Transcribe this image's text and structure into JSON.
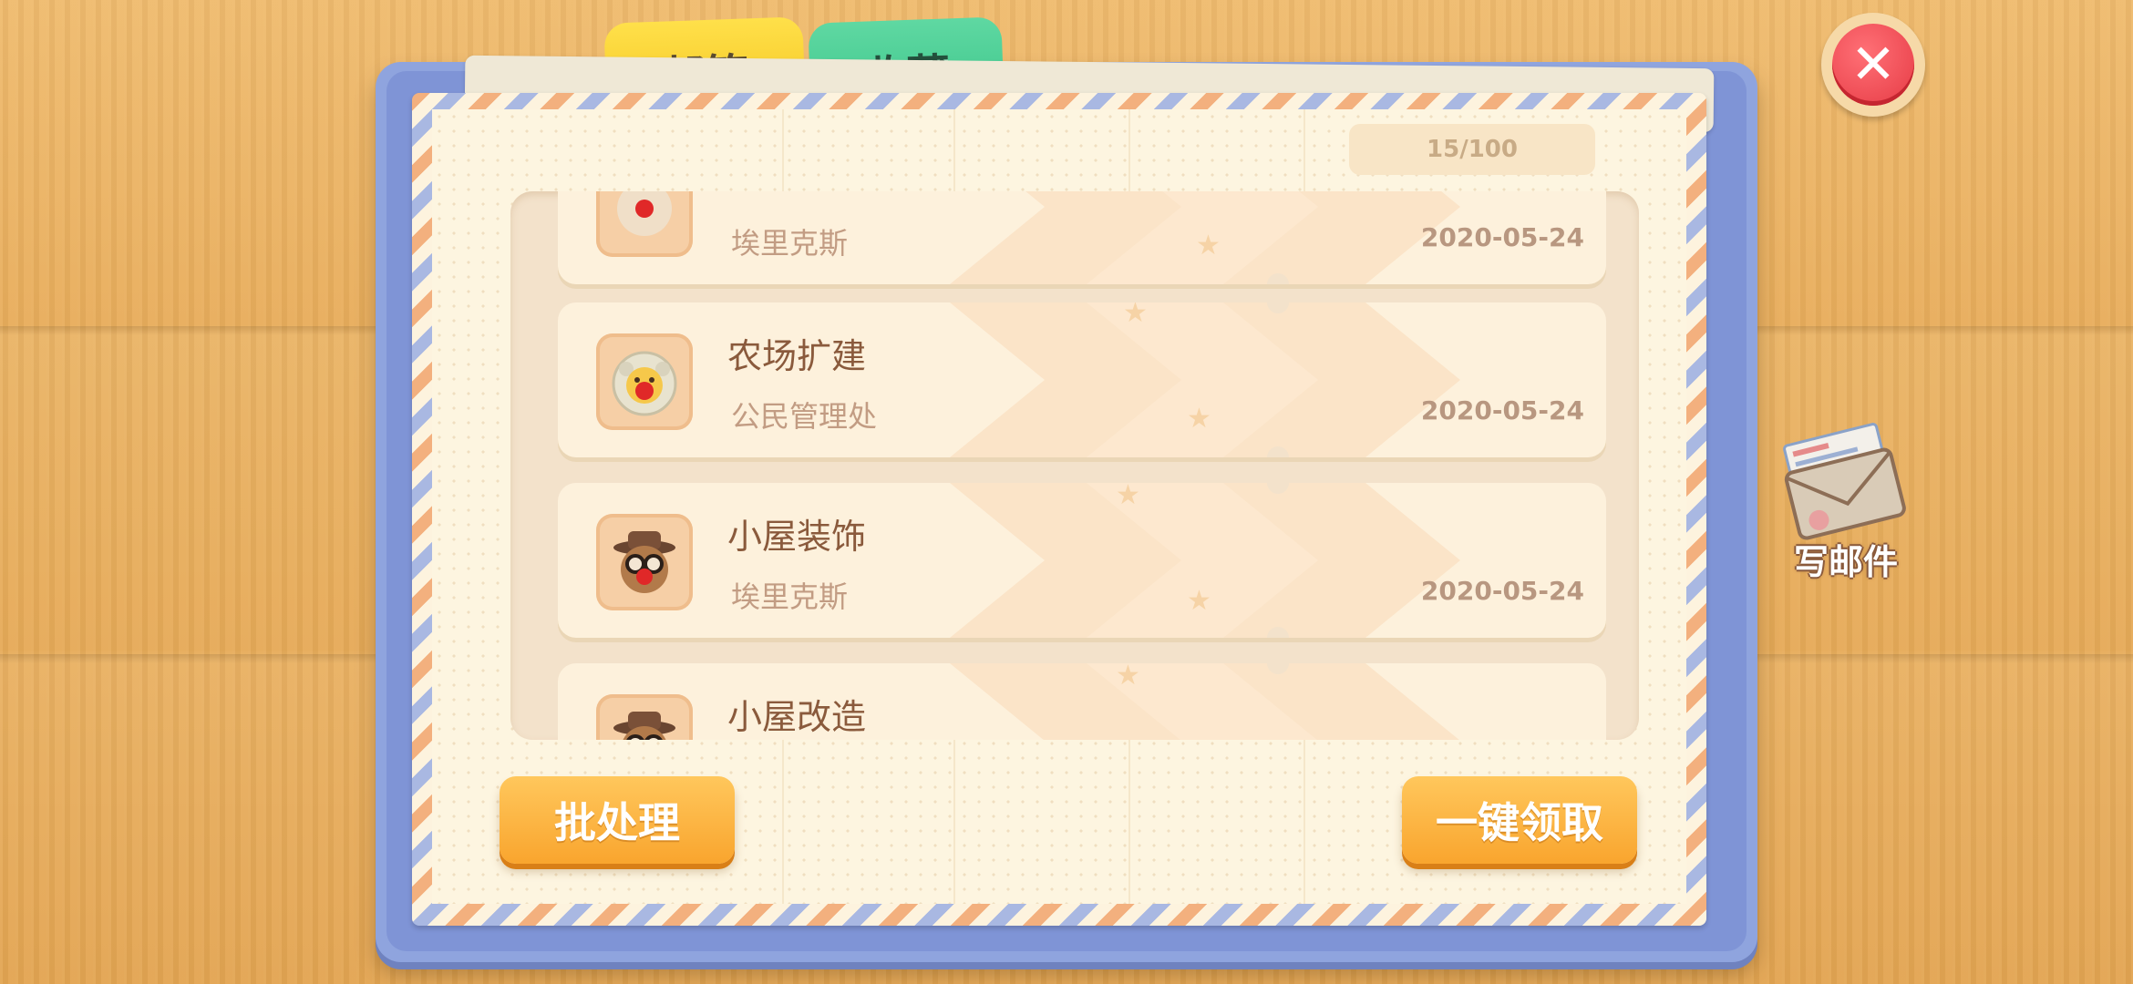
{
  "tabs": [
    {
      "label": "邮箱",
      "active": true
    },
    {
      "label": "收藏",
      "active": false
    }
  ],
  "counter": "15/100",
  "mails": [
    {
      "title": "",
      "sender": "埃里克斯",
      "date": "2020-05-24",
      "icon": "clown-avatar"
    },
    {
      "title": "农场扩建",
      "sender": "公民管理处",
      "date": "2020-05-24",
      "icon": "sheep-clown-avatar"
    },
    {
      "title": "小屋装饰",
      "sender": "埃里克斯",
      "date": "2020-05-24",
      "icon": "hat-glasses-clown-avatar"
    },
    {
      "title": "小屋改造",
      "sender": "",
      "date": "",
      "icon": "hat-glasses-clown-avatar"
    }
  ],
  "buttons": {
    "batch": "批处理",
    "claim_all": "一键领取"
  },
  "write_mail": "写邮件",
  "colors": {
    "accent_orange": "#f9a52e",
    "close_red": "#e63a44",
    "tab_yellow": "#f5c823",
    "tab_green": "#3ec78c",
    "frame_blue": "#8fa4de"
  }
}
